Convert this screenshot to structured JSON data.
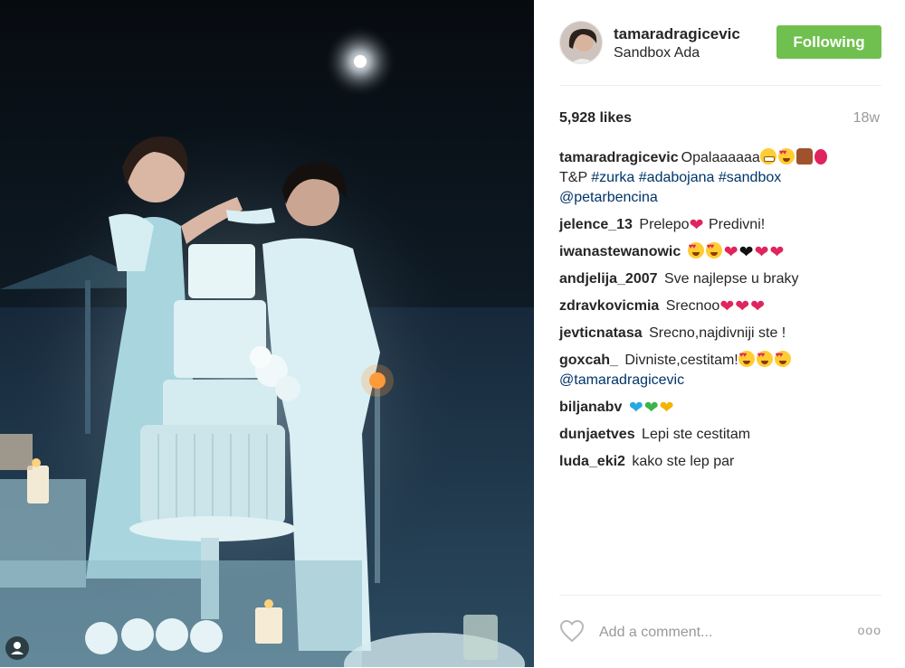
{
  "post": {
    "username": "tamaradragicevic",
    "location": "Sandbox Ada",
    "follow_label": "Following",
    "likes": "5,928 likes",
    "age": "18w",
    "comment_placeholder": "Add a comment...",
    "more_label": "ooo"
  },
  "caption": {
    "user": "tamaradragicevic",
    "text": "Opalaaaaaa",
    "line2_text": "T&P",
    "hashtags": [
      "#zurka",
      "#adabojana",
      "#sandbox"
    ],
    "mention": "@petarbencina"
  },
  "comments": [
    {
      "user": "jelence_13",
      "text_a": "Prelepo",
      "text_b": "Predivni!"
    },
    {
      "user": "iwanastewanowic",
      "text": ""
    },
    {
      "user": "andjelija_2007",
      "text": "Sve najlepse u braky"
    },
    {
      "user": "zdravkovicmia",
      "text": "Srecnoo"
    },
    {
      "user": "jevticnatasa",
      "text": "Srecno,najdivniji ste !"
    },
    {
      "user": "goxcah_",
      "text": "Divniste,cestitam!",
      "mention": "@tamaradragicevic"
    },
    {
      "user": "biljanabv",
      "text": ""
    },
    {
      "user": "dunjaetves",
      "text": "Lepi ste cestitam"
    },
    {
      "user": "luda_eki2",
      "text": "kako ste lep par"
    }
  ],
  "colors": {
    "follow_button": "#70c050",
    "link": "#003569",
    "secondary_text": "#999999"
  },
  "icons": [
    "heart-outline-icon",
    "more-options-icon",
    "user-tag-icon"
  ]
}
